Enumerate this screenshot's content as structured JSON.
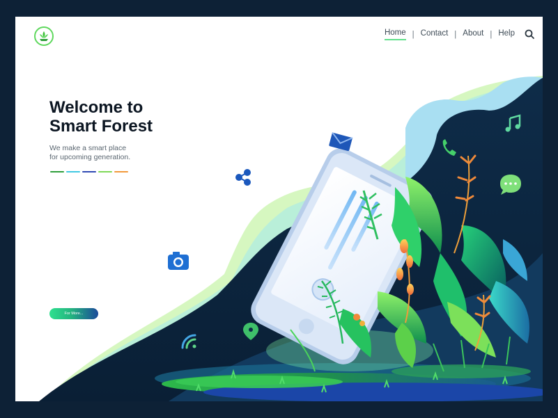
{
  "brand": {
    "logo_icon": "leaf-icon"
  },
  "nav": {
    "items": [
      {
        "label": "Home",
        "active": true
      },
      {
        "label": "Contact",
        "active": false
      },
      {
        "label": "About",
        "active": false
      },
      {
        "label": "Help",
        "active": false
      }
    ],
    "separator": "|",
    "search_icon": "search-icon"
  },
  "hero": {
    "title_line1": "Welcome to",
    "title_line2": "Smart Forest",
    "tagline_line1": "We make a smart place",
    "tagline_line2": "for upcoming generation.",
    "color_bar": [
      "#2e9e3a",
      "#3fc8e3",
      "#2f49b3",
      "#7ed957",
      "#f2993a"
    ],
    "cta_label": "For More..."
  },
  "illustration": {
    "floating_icons": [
      "envelope-icon",
      "share-icon",
      "camera-icon",
      "wifi-icon",
      "location-pin-icon",
      "phone-icon",
      "music-note-icon",
      "chat-bubble-icon"
    ],
    "colors": {
      "dark_navy": "#0b2741",
      "mid_blue": "#123a5e",
      "accent_green": "#2fd06a",
      "light_green": "#c7f5a7",
      "phone_blue": "#b9d3ef"
    }
  }
}
